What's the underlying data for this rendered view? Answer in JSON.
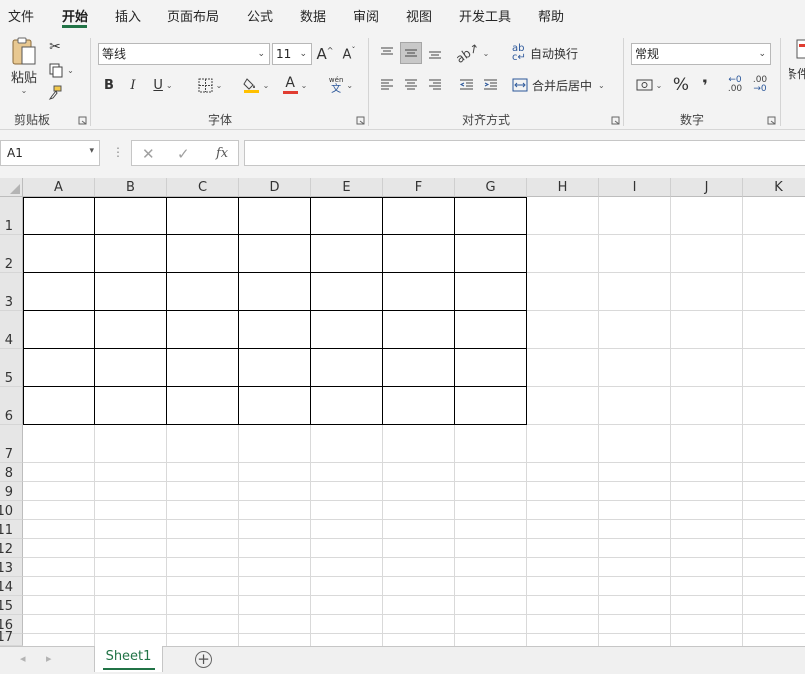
{
  "menu": {
    "tabs": [
      "文件",
      "开始",
      "插入",
      "页面布局",
      "公式",
      "数据",
      "审阅",
      "视图",
      "开发工具",
      "帮助"
    ],
    "active": "开始"
  },
  "ribbon": {
    "clipboard": {
      "paste_label": "粘贴",
      "group_label": "剪贴板"
    },
    "font": {
      "font_name": "等线",
      "font_size": "11",
      "grow_label": "A",
      "shrink_label": "A",
      "bold": "B",
      "italic": "I",
      "underline": "U",
      "font_color_label": "A",
      "phonetic_top": "wén",
      "phonetic_bottom": "文",
      "group_label": "字体"
    },
    "alignment": {
      "wrap_text": "自动换行",
      "merge_center": "合并后居中",
      "group_label": "对齐方式"
    },
    "number": {
      "format": "常规",
      "percent": "%",
      "comma": "❜",
      "inc_decimal": ".00",
      "dec_decimal": ".00",
      "group_label": "数字"
    },
    "styles": {
      "cond_format_partial": "条件"
    }
  },
  "formula_bar": {
    "name_box": "A1",
    "fx_label": "fx",
    "formula": ""
  },
  "grid": {
    "columns": [
      "A",
      "B",
      "C",
      "D",
      "E",
      "F",
      "G",
      "H",
      "I",
      "J",
      "K"
    ],
    "rows": [
      "1",
      "2",
      "3",
      "4",
      "5",
      "6",
      "7",
      "8",
      "9",
      "10",
      "11",
      "12",
      "13",
      "14",
      "15",
      "16",
      "17"
    ]
  },
  "sheets": {
    "tabs": [
      "Sheet1"
    ],
    "active": "Sheet1"
  },
  "colors": {
    "accent": "#217346",
    "ribbon_bg": "#f3f3f3",
    "header_bg": "#e6e6e6",
    "gridline": "#d9d9d9"
  }
}
